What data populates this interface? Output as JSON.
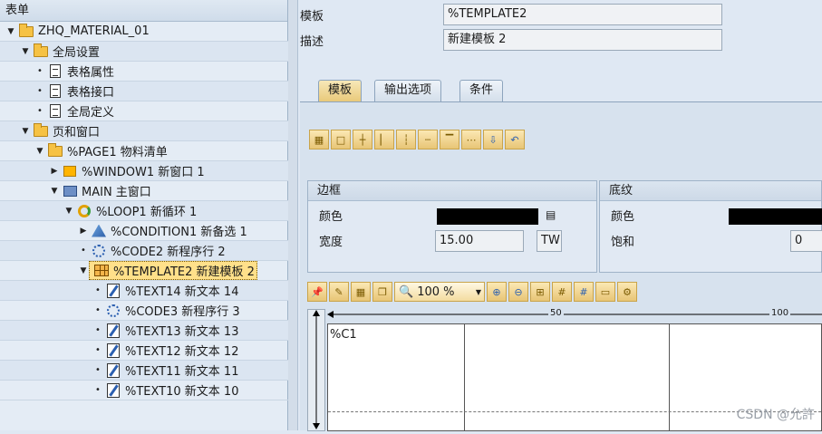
{
  "tree": {
    "header": "表单",
    "rows": [
      {
        "label": "ZHQ_MATERIAL_01",
        "icon": "folder-open-icon",
        "level": 0,
        "expander": "▼"
      },
      {
        "label": "全局设置",
        "icon": "folder-open-icon",
        "level": 1,
        "expander": "▼"
      },
      {
        "label": "表格属性",
        "icon": "document-icon",
        "level": 2,
        "expander": "•"
      },
      {
        "label": "表格接口",
        "icon": "document-icon",
        "level": 2,
        "expander": "•"
      },
      {
        "label": "全局定义",
        "icon": "document-icon",
        "level": 2,
        "expander": "•"
      },
      {
        "label": "页和窗口",
        "icon": "folder-open-icon",
        "level": 1,
        "expander": "▼"
      },
      {
        "label": "%PAGE1 物料清单",
        "icon": "folder-open-icon",
        "level": 2,
        "expander": "▼"
      },
      {
        "label": "%WINDOW1 新窗口 1",
        "icon": "window-icon",
        "level": 3,
        "expander": "▶"
      },
      {
        "label": "MAIN 主窗口",
        "icon": "main-window-icon",
        "level": 3,
        "expander": "▼"
      },
      {
        "label": "%LOOP1 新循环 1",
        "icon": "loop-icon",
        "level": 4,
        "expander": "▼"
      },
      {
        "label": "%CONDITION1 新备选 1",
        "icon": "condition-icon",
        "level": 5,
        "expander": "▶"
      },
      {
        "label": "%CODE2 新程序行 2",
        "icon": "code-icon",
        "level": 5,
        "expander": "•"
      },
      {
        "label": "%TEMPLATE2 新建模板 2",
        "icon": "template-grid-icon",
        "level": 5,
        "expander": "▼",
        "selected": true
      },
      {
        "label": "%TEXT14 新文本 14",
        "icon": "text-icon",
        "level": 6,
        "expander": "•"
      },
      {
        "label": "%CODE3 新程序行 3",
        "icon": "code-icon",
        "level": 6,
        "expander": "•"
      },
      {
        "label": "%TEXT13 新文本 13",
        "icon": "text-icon",
        "level": 6,
        "expander": "•"
      },
      {
        "label": "%TEXT12 新文本 12",
        "icon": "text-icon",
        "level": 6,
        "expander": "•"
      },
      {
        "label": "%TEXT11 新文本 11",
        "icon": "text-icon",
        "level": 6,
        "expander": "•"
      },
      {
        "label": "%TEXT10 新文本 10",
        "icon": "text-icon",
        "level": 6,
        "expander": "•"
      }
    ]
  },
  "form": {
    "template_label": "模板",
    "template_value": "%TEMPLATE2",
    "desc_label": "描述",
    "desc_value": "新建模板 2"
  },
  "tabs": [
    {
      "label": "模板",
      "active": true
    },
    {
      "label": "输出选项",
      "active": false
    },
    {
      "label": "条件",
      "active": false
    }
  ],
  "border_box": {
    "title": "边框",
    "color_label": "颜色",
    "width_label": "宽度",
    "width_value": "15.00",
    "unit_value": "TW"
  },
  "shading_box": {
    "title": "底纹",
    "color_label": "颜色",
    "saturation_label": "饱和",
    "saturation_value": "0"
  },
  "toolbar2": {
    "zoom_value": "100 %"
  },
  "ruler": {
    "mark_50": "50",
    "mark_100": "100"
  },
  "canvas": {
    "cell_text": "%C1"
  },
  "watermark": "CSDN @允許"
}
